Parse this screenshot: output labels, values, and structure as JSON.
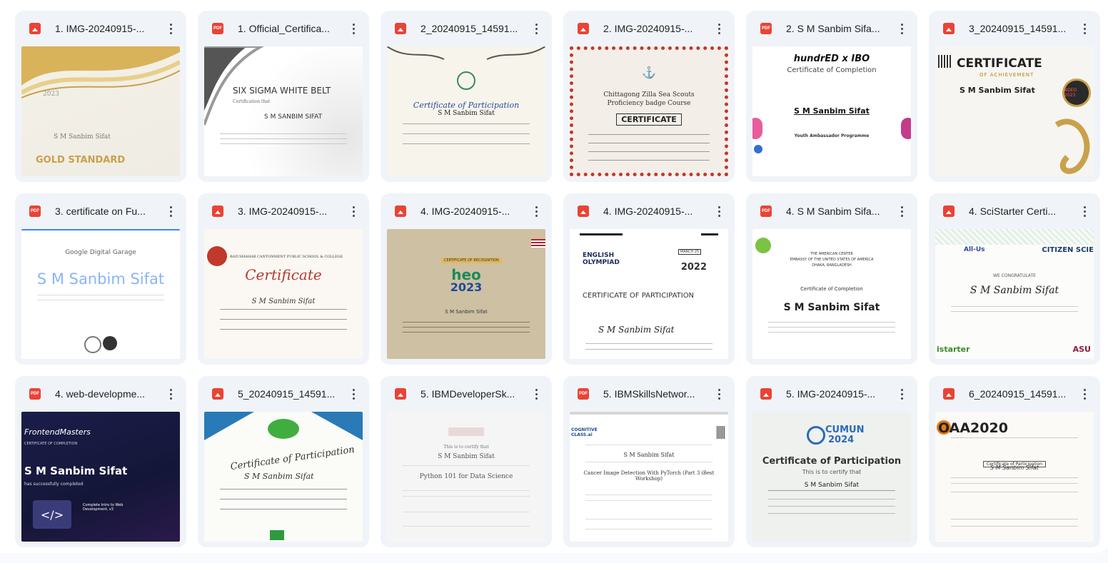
{
  "files": [
    {
      "name": "1. IMG-20240915-...",
      "type": "image",
      "thumb": {
        "lines": [
          "GOLD STANDARD",
          "S M Sanbim Sifat",
          "2023"
        ]
      }
    },
    {
      "name": "1. Official_Certifica...",
      "type": "pdf",
      "thumb": {
        "lines": [
          "SIX SIGMA WHITE BELT",
          "Certification that",
          "S M SANBIM SIFAT"
        ]
      }
    },
    {
      "name": "2_20240915_14591...",
      "type": "image",
      "thumb": {
        "lines": [
          "Certificate of Participation",
          "S M Sanbim Sifat"
        ]
      }
    },
    {
      "name": "2. IMG-20240915-...",
      "type": "image",
      "thumb": {
        "lines": [
          "Chittagong Zilla Sea Scouts",
          "Proficiency badge Course",
          "CERTIFICATE"
        ]
      }
    },
    {
      "name": "2. S M Sanbim Sifa...",
      "type": "pdf",
      "thumb": {
        "lines": [
          "hundrED x IBO",
          "Certificate of Completion",
          "S M Sanbim Sifat",
          "Youth Ambassador Programme"
        ]
      }
    },
    {
      "name": "3_20240915_14591...",
      "type": "image",
      "thumb": {
        "lines": [
          "CERTIFICATE",
          "OF ACHIEVEMENT",
          "S M Sanbim Sifat",
          "BDEO 2023"
        ]
      }
    },
    {
      "name": "3. certificate on Fu...",
      "type": "pdf",
      "thumb": {
        "lines": [
          "Google Digital Garage",
          "S M Sanbim Sifat"
        ]
      }
    },
    {
      "name": "3. IMG-20240915-...",
      "type": "image",
      "thumb": {
        "lines": [
          "BAIUSHAHAB CANTONMENT PUBLIC SCHOOL & COLLEGE",
          "Certificate",
          "S M Sanbim Sifat"
        ]
      }
    },
    {
      "name": "4. IMG-20240915-...",
      "type": "image",
      "thumb": {
        "lines": [
          "CERTIFICATE OF RECOGNITION",
          "heo",
          "2023",
          "S M Sanbim Sifat"
        ]
      }
    },
    {
      "name": "4. IMG-20240915-...",
      "type": "image",
      "thumb": {
        "lines": [
          "ENGLISH OLYMPIAD",
          "MARCH 25",
          "2022",
          "CERTIFICATE OF PARTICIPATION",
          "S M Sanbim Sifat"
        ]
      }
    },
    {
      "name": "4. S M Sanbim Sifa...",
      "type": "pdf",
      "thumb": {
        "lines": [
          "THE AMERICAN CENTER",
          "EMBASSY OF THE UNITED STATES OF AMERICA",
          "DHAKA, BANGLADESH",
          "Certificate of Completion",
          "S M Sanbim Sifat"
        ]
      }
    },
    {
      "name": "4. SciStarter Certi...",
      "type": "image",
      "thumb": {
        "lines": [
          "All-Us",
          "CITIZEN SCIE",
          "WE CONGRATULATE",
          "S M Sanbim Sifat",
          "istarter",
          "ASU"
        ]
      }
    },
    {
      "name": "4. web-developme...",
      "type": "pdf",
      "thumb": {
        "lines": [
          "FrontendMasters",
          "CERTIFICATE OF COMPLETION",
          "S M Sanbim Sifat",
          "has successfully completed",
          "Complete Intro to Web Development, v3"
        ]
      }
    },
    {
      "name": "5_20240915_14591...",
      "type": "image",
      "thumb": {
        "lines": [
          "Certificate of Participation",
          "S M Sanbim Sifat"
        ]
      }
    },
    {
      "name": "5. IBMDeveloperSk...",
      "type": "image",
      "thumb": {
        "lines": [
          "This is to certify that",
          "S M Sanbim Sifat",
          "Python 101 for Data Science"
        ]
      }
    },
    {
      "name": "5. IBMSkillsNetwor...",
      "type": "pdf",
      "thumb": {
        "lines": [
          "COGNITIVE CLASS.ai",
          "S M Sanbim Sifat",
          "Cancer Image Detection With PyTorch (Part 3 iBest Workshop)"
        ]
      }
    },
    {
      "name": "5. IMG-20240915-...",
      "type": "image",
      "thumb": {
        "lines": [
          "CUMUN",
          "2024",
          "Certificate of Participation",
          "This is to certify that",
          "S M Sanbim Sifat"
        ]
      }
    },
    {
      "name": "6_20240915_14591...",
      "type": "image",
      "thumb": {
        "lines": [
          "OAA2020",
          "Certificate of Participation",
          "S M Sanbim Sifat"
        ]
      }
    }
  ],
  "icons": {
    "pdf": "pdf-file-icon",
    "image": "image-file-icon",
    "more": "more-vert-icon"
  },
  "colors": {
    "file_icon": "#ea4335",
    "card_bg": "#f0f4f9",
    "page_bg": "#f8fafd"
  }
}
